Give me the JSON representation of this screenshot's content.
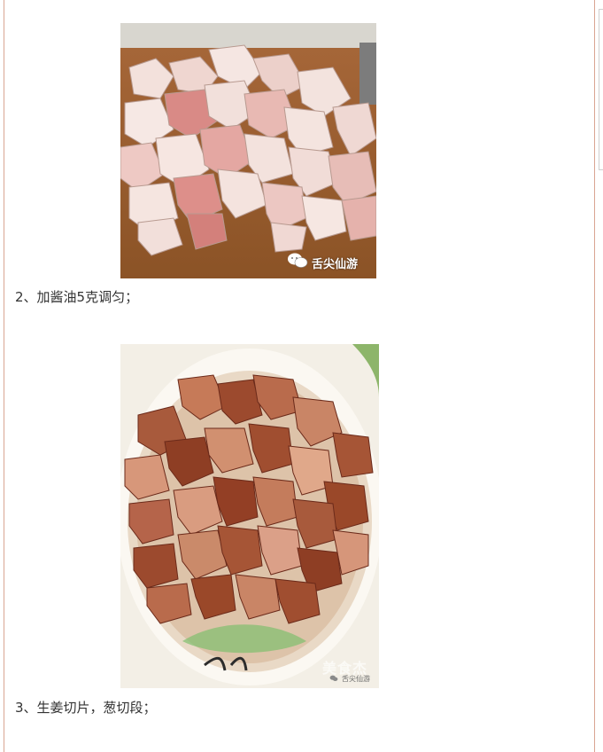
{
  "steps": [
    {
      "text": "2、加酱油5克调匀；"
    },
    {
      "text": "3、生姜切片，葱切段；"
    }
  ],
  "images": [
    {
      "icon": "wechat-icon",
      "watermark": "舌尖仙游"
    },
    {
      "icon": "wechat-icon",
      "watermark": "舌尖仙游",
      "brand_mark": "美食杰"
    }
  ]
}
